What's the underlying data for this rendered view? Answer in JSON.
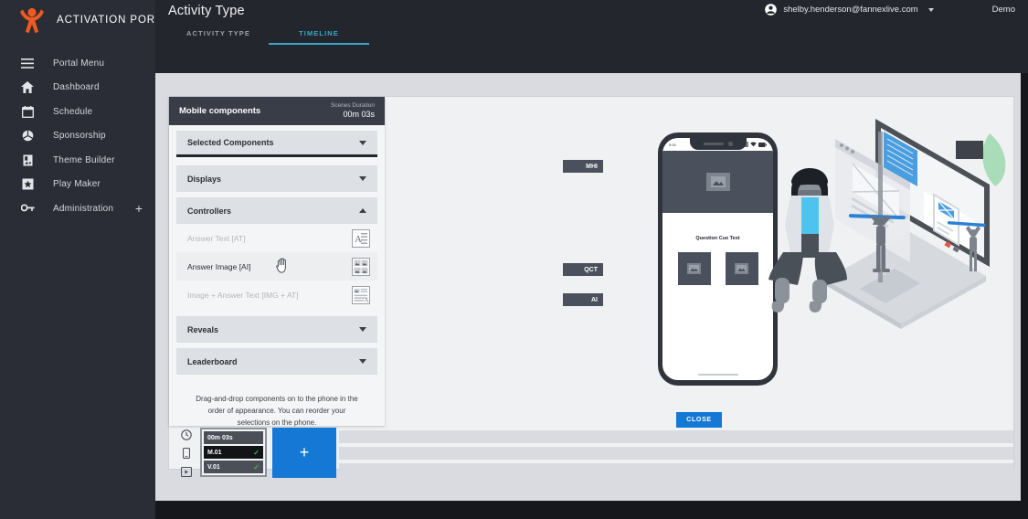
{
  "sidebar": {
    "brand": "ACTIVATION PORTAL",
    "items": [
      {
        "label": "Portal Menu",
        "icon": "hamburger-icon"
      },
      {
        "label": "Dashboard",
        "icon": "home-icon"
      },
      {
        "label": "Schedule",
        "icon": "calendar-icon"
      },
      {
        "label": "Sponsorship",
        "icon": "globe-icon"
      },
      {
        "label": "Theme Builder",
        "icon": "theme-icon"
      },
      {
        "label": "Play Maker",
        "icon": "star-badge-icon"
      },
      {
        "label": "Administration",
        "icon": "key-icon",
        "expand": "+"
      }
    ]
  },
  "header": {
    "title": "Activity Type",
    "tabs": [
      {
        "label": "ACTIVITY TYPE",
        "active": false
      },
      {
        "label": "TIMELINE",
        "active": true
      }
    ],
    "user_email": "shelby.henderson@fannexlive.com",
    "demo_label": "Demo",
    "accent": "#3aa6c4"
  },
  "panel": {
    "title": "Mobile components",
    "duration_label": "Scenes Duration",
    "duration_value": "00m 03s",
    "sections": [
      {
        "label": "Selected Components",
        "state": "collapsed"
      },
      {
        "label": "Displays",
        "state": "collapsed"
      },
      {
        "label": "Controllers",
        "state": "expanded"
      }
    ],
    "controllers": [
      {
        "label": "Answer Text [AT]",
        "icon": "answer-text-icon",
        "enabled": false
      },
      {
        "label": "Answer Image [AI]",
        "icon": "answer-image-icon",
        "enabled": true
      },
      {
        "label": "Image + Answer Text [IMG + AT]",
        "icon": "image-answer-text-icon",
        "enabled": false
      }
    ],
    "sections_after": [
      {
        "label": "Reveals",
        "state": "collapsed"
      },
      {
        "label": "Leaderboard",
        "state": "collapsed"
      }
    ],
    "hint": "Drag-and-drop components on to the phone in the order of appearance. You can reorder your selections on the phone."
  },
  "timeline": {
    "gutter_icons": [
      "clock-icon",
      "mobile-icon",
      "video-icon"
    ],
    "chips": [
      {
        "label": "00m 03s",
        "checked": false
      },
      {
        "label": "M.01",
        "checked": true
      },
      {
        "label": "V.01",
        "checked": true
      }
    ],
    "add_label": "+",
    "add_color": "#1478d4",
    "empty_rows": 3
  },
  "preview": {
    "status_time": "9:00",
    "tags": [
      {
        "label": "MHI"
      },
      {
        "label": "QCT"
      },
      {
        "label": "AI"
      }
    ],
    "question_cue_text": "Question Cue Text",
    "close_label": "CLOSE",
    "close_color": "#1478d4"
  }
}
